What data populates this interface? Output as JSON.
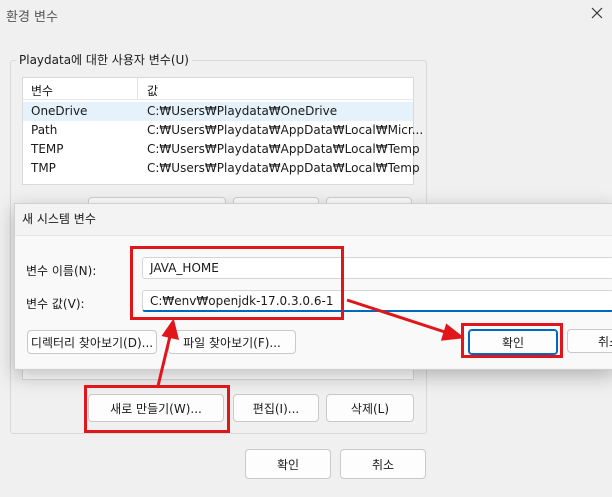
{
  "window": {
    "title": "환경 변수"
  },
  "user_group": {
    "label": "Playdata에 대한 사용자 변수(U)",
    "columns": [
      "변수",
      "값"
    ],
    "rows": [
      {
        "name": "OneDrive",
        "value": "C:₩Users₩Playdata₩OneDrive"
      },
      {
        "name": "Path",
        "value": "C:₩Users₩Playdata₩AppData₩Local₩Micr..."
      },
      {
        "name": "TEMP",
        "value": "C:₩Users₩Playdata₩AppData₩Local₩Temp"
      },
      {
        "name": "TMP",
        "value": "C:₩Users₩Playdata₩AppData₩Local₩Temp"
      }
    ]
  },
  "system_buttons": {
    "new": "새로 만들기(W)...",
    "edit": "편집(I)...",
    "delete": "삭제(L)"
  },
  "footer": {
    "ok": "확인",
    "cancel": "취소"
  },
  "dialog": {
    "title": "새 시스템 변수",
    "name_label": "변수 이름(N):",
    "name_value": "JAVA_HOME",
    "value_label": "변수 값(V):",
    "value_value": "C:₩env₩openjdk-17.0.3.0.6-1",
    "browse_dir": "디렉터리 찾아보기(D)...",
    "browse_file": "파일 찾아보기(F)...",
    "ok": "확인",
    "cancel": "취소"
  },
  "annotation_color": "#e0161b"
}
